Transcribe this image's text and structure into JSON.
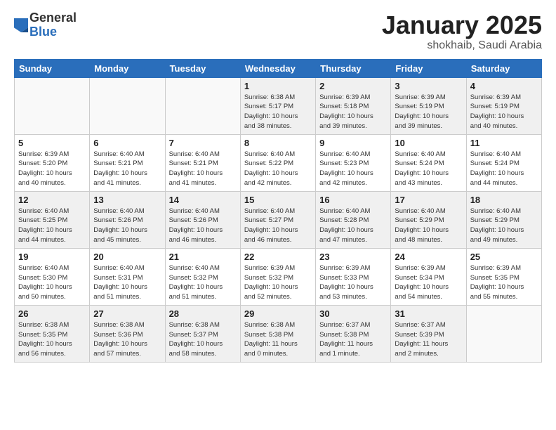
{
  "logo": {
    "general": "General",
    "blue": "Blue"
  },
  "header": {
    "month": "January 2025",
    "location": "shokhaib, Saudi Arabia"
  },
  "days_of_week": [
    "Sunday",
    "Monday",
    "Tuesday",
    "Wednesday",
    "Thursday",
    "Friday",
    "Saturday"
  ],
  "weeks": [
    [
      {
        "day": "",
        "info": ""
      },
      {
        "day": "",
        "info": ""
      },
      {
        "day": "",
        "info": ""
      },
      {
        "day": "1",
        "info": "Sunrise: 6:38 AM\nSunset: 5:17 PM\nDaylight: 10 hours\nand 38 minutes."
      },
      {
        "day": "2",
        "info": "Sunrise: 6:39 AM\nSunset: 5:18 PM\nDaylight: 10 hours\nand 39 minutes."
      },
      {
        "day": "3",
        "info": "Sunrise: 6:39 AM\nSunset: 5:19 PM\nDaylight: 10 hours\nand 39 minutes."
      },
      {
        "day": "4",
        "info": "Sunrise: 6:39 AM\nSunset: 5:19 PM\nDaylight: 10 hours\nand 40 minutes."
      }
    ],
    [
      {
        "day": "5",
        "info": "Sunrise: 6:39 AM\nSunset: 5:20 PM\nDaylight: 10 hours\nand 40 minutes."
      },
      {
        "day": "6",
        "info": "Sunrise: 6:40 AM\nSunset: 5:21 PM\nDaylight: 10 hours\nand 41 minutes."
      },
      {
        "day": "7",
        "info": "Sunrise: 6:40 AM\nSunset: 5:21 PM\nDaylight: 10 hours\nand 41 minutes."
      },
      {
        "day": "8",
        "info": "Sunrise: 6:40 AM\nSunset: 5:22 PM\nDaylight: 10 hours\nand 42 minutes."
      },
      {
        "day": "9",
        "info": "Sunrise: 6:40 AM\nSunset: 5:23 PM\nDaylight: 10 hours\nand 42 minutes."
      },
      {
        "day": "10",
        "info": "Sunrise: 6:40 AM\nSunset: 5:24 PM\nDaylight: 10 hours\nand 43 minutes."
      },
      {
        "day": "11",
        "info": "Sunrise: 6:40 AM\nSunset: 5:24 PM\nDaylight: 10 hours\nand 44 minutes."
      }
    ],
    [
      {
        "day": "12",
        "info": "Sunrise: 6:40 AM\nSunset: 5:25 PM\nDaylight: 10 hours\nand 44 minutes."
      },
      {
        "day": "13",
        "info": "Sunrise: 6:40 AM\nSunset: 5:26 PM\nDaylight: 10 hours\nand 45 minutes."
      },
      {
        "day": "14",
        "info": "Sunrise: 6:40 AM\nSunset: 5:26 PM\nDaylight: 10 hours\nand 46 minutes."
      },
      {
        "day": "15",
        "info": "Sunrise: 6:40 AM\nSunset: 5:27 PM\nDaylight: 10 hours\nand 46 minutes."
      },
      {
        "day": "16",
        "info": "Sunrise: 6:40 AM\nSunset: 5:28 PM\nDaylight: 10 hours\nand 47 minutes."
      },
      {
        "day": "17",
        "info": "Sunrise: 6:40 AM\nSunset: 5:29 PM\nDaylight: 10 hours\nand 48 minutes."
      },
      {
        "day": "18",
        "info": "Sunrise: 6:40 AM\nSunset: 5:29 PM\nDaylight: 10 hours\nand 49 minutes."
      }
    ],
    [
      {
        "day": "19",
        "info": "Sunrise: 6:40 AM\nSunset: 5:30 PM\nDaylight: 10 hours\nand 50 minutes."
      },
      {
        "day": "20",
        "info": "Sunrise: 6:40 AM\nSunset: 5:31 PM\nDaylight: 10 hours\nand 51 minutes."
      },
      {
        "day": "21",
        "info": "Sunrise: 6:40 AM\nSunset: 5:32 PM\nDaylight: 10 hours\nand 51 minutes."
      },
      {
        "day": "22",
        "info": "Sunrise: 6:39 AM\nSunset: 5:32 PM\nDaylight: 10 hours\nand 52 minutes."
      },
      {
        "day": "23",
        "info": "Sunrise: 6:39 AM\nSunset: 5:33 PM\nDaylight: 10 hours\nand 53 minutes."
      },
      {
        "day": "24",
        "info": "Sunrise: 6:39 AM\nSunset: 5:34 PM\nDaylight: 10 hours\nand 54 minutes."
      },
      {
        "day": "25",
        "info": "Sunrise: 6:39 AM\nSunset: 5:35 PM\nDaylight: 10 hours\nand 55 minutes."
      }
    ],
    [
      {
        "day": "26",
        "info": "Sunrise: 6:38 AM\nSunset: 5:35 PM\nDaylight: 10 hours\nand 56 minutes."
      },
      {
        "day": "27",
        "info": "Sunrise: 6:38 AM\nSunset: 5:36 PM\nDaylight: 10 hours\nand 57 minutes."
      },
      {
        "day": "28",
        "info": "Sunrise: 6:38 AM\nSunset: 5:37 PM\nDaylight: 10 hours\nand 58 minutes."
      },
      {
        "day": "29",
        "info": "Sunrise: 6:38 AM\nSunset: 5:38 PM\nDaylight: 11 hours\nand 0 minutes."
      },
      {
        "day": "30",
        "info": "Sunrise: 6:37 AM\nSunset: 5:38 PM\nDaylight: 11 hours\nand 1 minute."
      },
      {
        "day": "31",
        "info": "Sunrise: 6:37 AM\nSunset: 5:39 PM\nDaylight: 11 hours\nand 2 minutes."
      },
      {
        "day": "",
        "info": ""
      }
    ]
  ]
}
